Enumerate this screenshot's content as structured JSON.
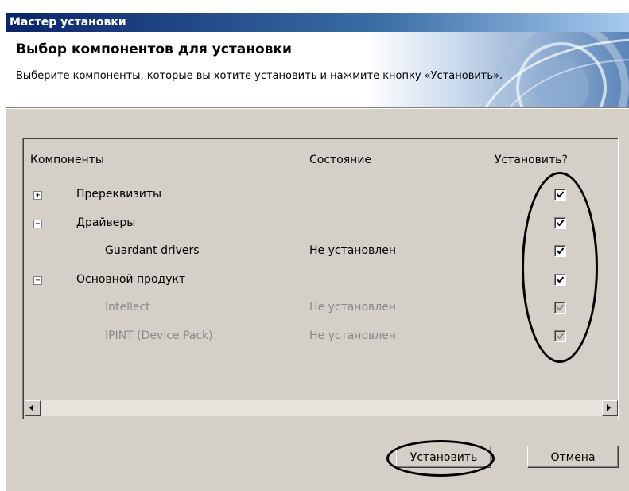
{
  "window": {
    "title": "Мастер установки"
  },
  "header": {
    "title": "Выбор компонентов для установки",
    "subtitle": "Выберите компоненты, которые вы хотите установить и нажмите кнопку «Установить»."
  },
  "tree": {
    "columns": {
      "component": "Компоненты",
      "status": "Состояние",
      "install": "Установить?"
    },
    "rows": [
      {
        "expander": "+",
        "name": "Пререквизиты",
        "status": "",
        "checked": true,
        "enabled": true,
        "level": 0
      },
      {
        "expander": "−",
        "name": "Драйверы",
        "status": "",
        "checked": true,
        "enabled": true,
        "level": 0
      },
      {
        "expander": "",
        "name": "Guardant drivers",
        "status": "Не установлен",
        "checked": true,
        "enabled": true,
        "level": 1
      },
      {
        "expander": "−",
        "name": "Основной продукт",
        "status": "",
        "checked": true,
        "enabled": true,
        "level": 0
      },
      {
        "expander": "",
        "name": "Intellect",
        "status": "Не установлен",
        "checked": true,
        "enabled": false,
        "level": 1
      },
      {
        "expander": "",
        "name": "IPINT (Device Pack)",
        "status": "Не установлен",
        "checked": true,
        "enabled": false,
        "level": 1
      }
    ]
  },
  "buttons": {
    "install": "Установить",
    "cancel": "Отмена"
  }
}
